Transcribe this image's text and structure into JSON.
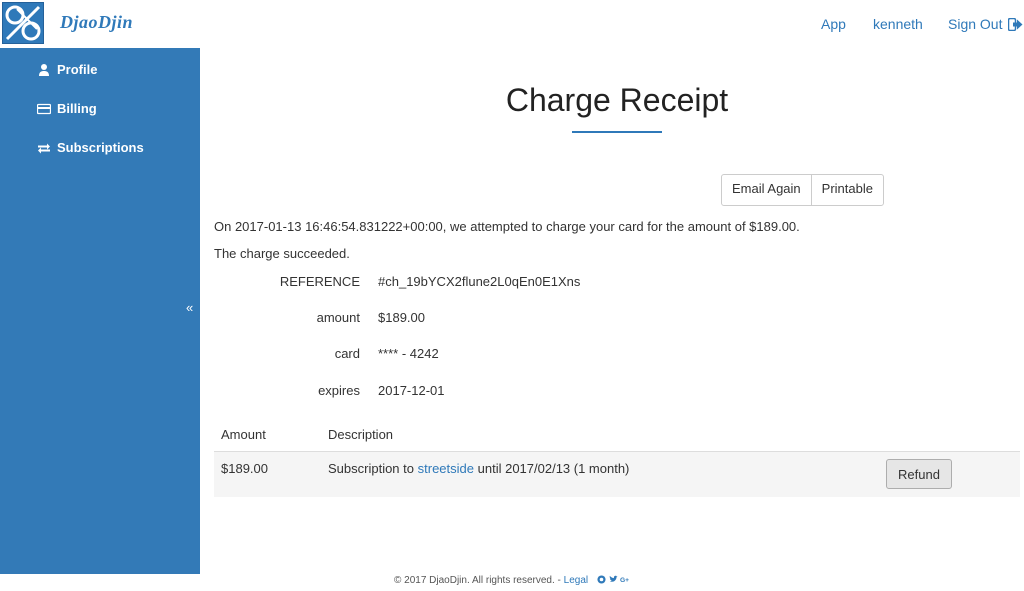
{
  "app": {
    "brand": "DjaoDjin"
  },
  "topnav": {
    "app": "App",
    "user": "kenneth",
    "signout": "Sign Out"
  },
  "sidebar": {
    "items": [
      {
        "label": "Profile",
        "icon": "user-icon"
      },
      {
        "label": "Billing",
        "icon": "credit-card-icon"
      },
      {
        "label": "Subscriptions",
        "icon": "exchange-icon"
      }
    ],
    "collapse": "«"
  },
  "page": {
    "title": "Charge Receipt",
    "actions": {
      "email_again": "Email Again",
      "printable": "Printable"
    },
    "summary": "On 2017-01-13 16:46:54.831222+00:00, we attempted to charge your card for the amount of $189.00.",
    "status": "The charge succeeded.",
    "details": [
      {
        "label": "REFERENCE",
        "value": "#ch_19bYCX2flune2L0qEn0E1Xns"
      },
      {
        "label": "amount",
        "value": "$189.00"
      },
      {
        "label": "card",
        "value": "**** - 4242"
      },
      {
        "label": "expires",
        "value": "2017-12-01"
      }
    ],
    "table": {
      "headers": {
        "amount": "Amount",
        "description": "Description"
      },
      "rows": [
        {
          "amount": "$189.00",
          "desc_prefix": "Subscription to",
          "desc_link": "streetside",
          "desc_suffix": "until 2017/02/13 (1 month)",
          "action": "Refund"
        }
      ]
    }
  },
  "footer": {
    "text": "© 2017 DjaoDjin. All rights reserved. -",
    "legal": "Legal"
  },
  "colors": {
    "accent": "#337ab7",
    "link": "#2f79b9"
  }
}
